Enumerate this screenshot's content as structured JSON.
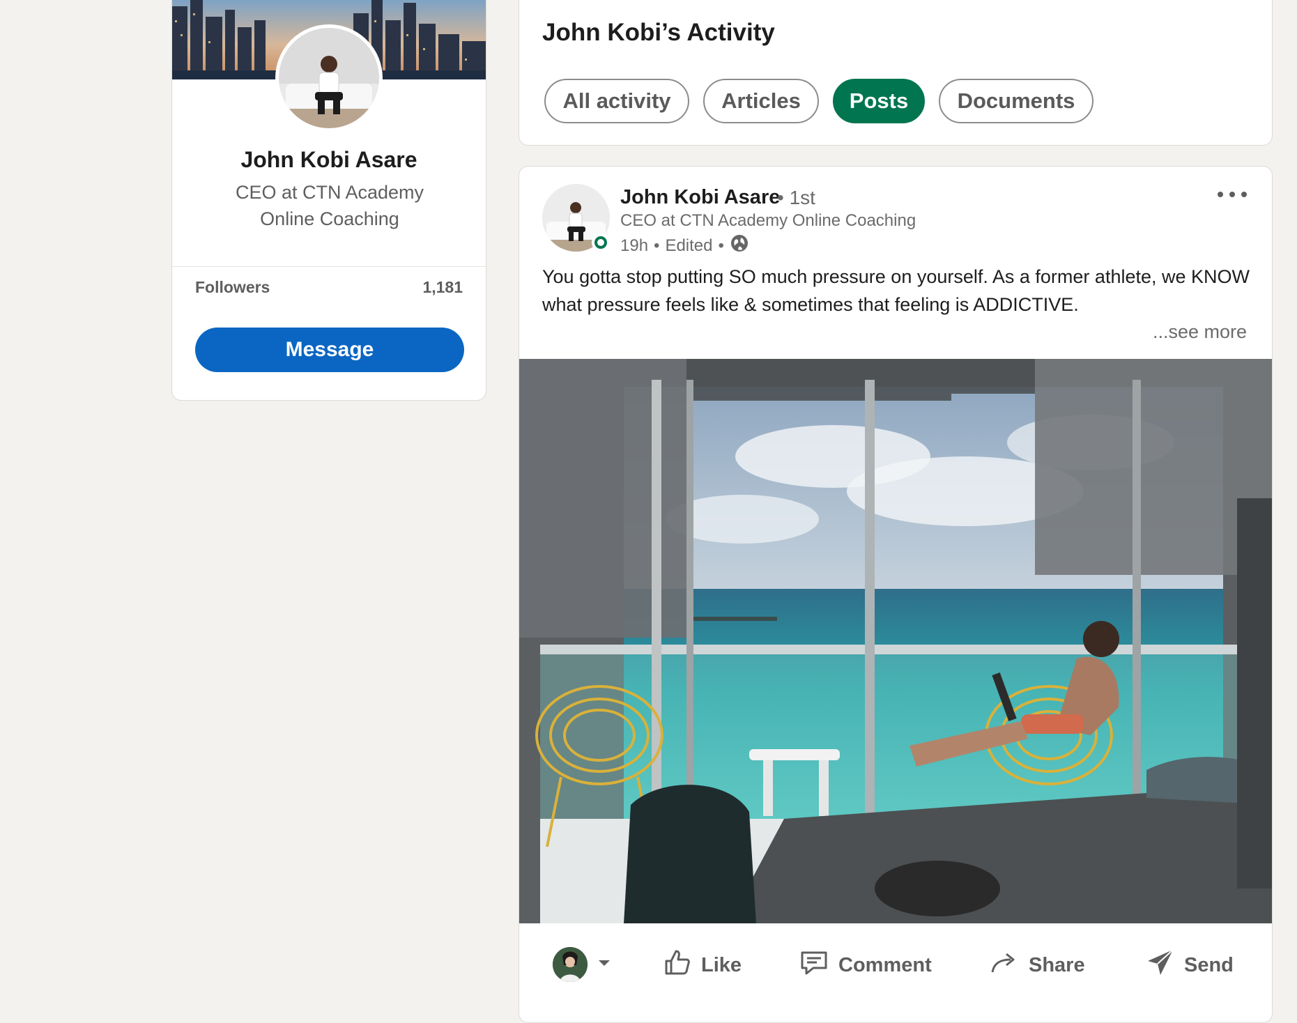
{
  "profile": {
    "name": "John Kobi Asare",
    "headline": "CEO at CTN Academy Online Coaching",
    "followers_label": "Followers",
    "followers_count": "1,181",
    "message_label": "Message"
  },
  "activity": {
    "title": "John Kobi’s Activity",
    "filters": [
      {
        "label": "All activity",
        "active": false
      },
      {
        "label": "Articles",
        "active": false
      },
      {
        "label": "Posts",
        "active": true
      },
      {
        "label": "Documents",
        "active": false
      }
    ]
  },
  "post": {
    "author": "John Kobi Asare",
    "degree": "• 1st",
    "headline": "CEO at CTN Academy Online Coaching",
    "time": "19h",
    "edited": "Edited",
    "text": "You gotta stop putting SO much pressure on yourself. As a former athlete, we KNOW what pressure feels like & sometimes that feeling is ADDICTIVE.",
    "see_more": "...see more",
    "actions": {
      "like": "Like",
      "comment": "Comment",
      "share": "Share",
      "send": "Send"
    }
  },
  "colors": {
    "accent_blue": "#0a66c2",
    "active_green": "#01754f",
    "page_bg": "#f3f2ef"
  },
  "icons": [
    "globe-icon",
    "more-icon",
    "like-icon",
    "comment-icon",
    "share-icon",
    "send-icon",
    "caret-down-icon"
  ]
}
